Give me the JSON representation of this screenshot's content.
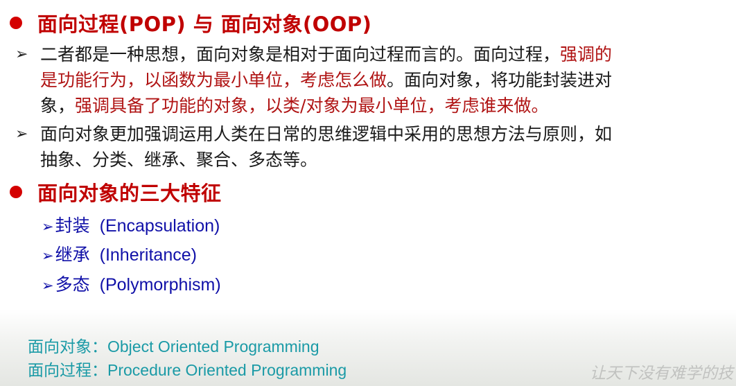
{
  "heading1": "面向过程(POP) 与 面向对象(OOP)",
  "para1": {
    "line1_a": "二者都是一种思想，面向对象是相对于面向过程而言的。面向过程，",
    "line1_b": "强调的",
    "line2_a": "是功能行为，以函数为最小单位，考虑怎么做",
    "line2_b": "。面向对象，将功能封装进对",
    "line3_a": "象，",
    "line3_b": "强调具备了功能的对象，以类/对象为最小单位，考虑谁来做。"
  },
  "para2": {
    "line1": "面向对象更加强调运用人类在日常的思维逻辑中采用的思想方法与原则，如",
    "line2": "抽象、分类、继承、聚合、多态等。"
  },
  "heading2": "面向对象的三大特征",
  "features": [
    {
      "cn": "封装",
      "en": "(Encapsulation)"
    },
    {
      "cn": "继承",
      "en": "(Inheritance)"
    },
    {
      "cn": "多态",
      "en": "(Polymorphism)"
    }
  ],
  "notes": [
    {
      "cn": "面向对象：",
      "en": "Object Oriented Programming"
    },
    {
      "cn": "面向过程：",
      "en": "Procedure Oriented Programming"
    }
  ],
  "watermark": "让天下没有难学的技",
  "colors": {
    "heading": "#c00000",
    "emphasis": "#b01414",
    "feature": "#1010a8",
    "note": "#1a9aa6"
  },
  "icons": {
    "bullet": "filled-circle",
    "arrow": "arrowhead-right"
  }
}
